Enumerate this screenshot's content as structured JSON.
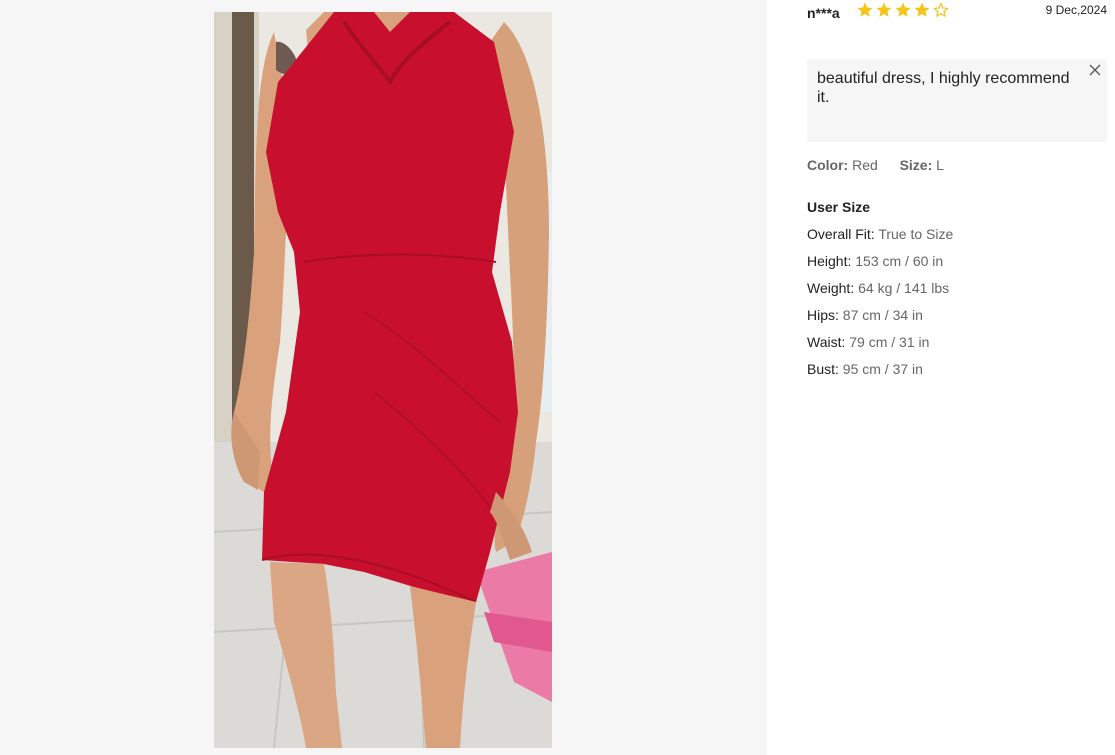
{
  "review": {
    "reviewer": "n***a",
    "rating": 4,
    "rating_max": 5,
    "date": "9 Dec,2024",
    "comment": "beautiful dress, I highly recommend it.",
    "color_label": "Color:",
    "color_value": "Red",
    "size_label": "Size:",
    "size_value": "L"
  },
  "user_size": {
    "title": "User Size",
    "items": [
      {
        "label": "Overall Fit:",
        "value": "True to Size"
      },
      {
        "label": "Height:",
        "value": "153 cm / 60 in"
      },
      {
        "label": "Weight:",
        "value": "64 kg / 141 lbs"
      },
      {
        "label": "Hips:",
        "value": "87 cm / 34 in"
      },
      {
        "label": "Waist:",
        "value": "79 cm / 31 in"
      },
      {
        "label": "Bust:",
        "value": "95 cm / 37 in"
      }
    ]
  },
  "icons": {
    "star_filled": "star-filled-icon",
    "star_empty": "star-outline-icon",
    "close": "close-icon"
  },
  "colors": {
    "star": "#f5c518",
    "dress": "#c8102e",
    "comment_bg": "#f6f6f6",
    "viewer_bg": "#f6f6f6"
  }
}
